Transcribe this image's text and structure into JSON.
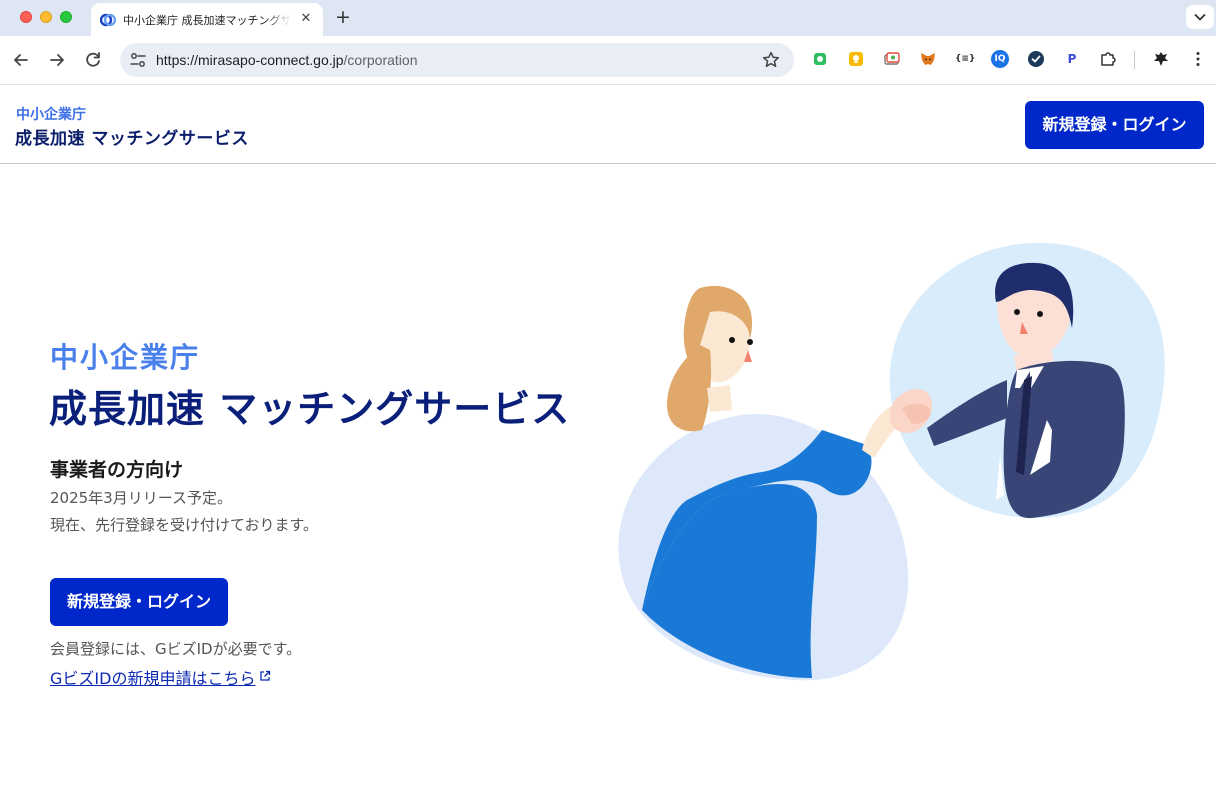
{
  "browser": {
    "tab_title": "中小企業庁 成長加速マッチングサービス",
    "url_host": "https://mirasapo-connect.go.jp",
    "url_path": "/corporation",
    "tab_close_glyph": "✕",
    "new_tab_glyph": "+",
    "extensions": [
      {
        "name": "evernote-extension-icon",
        "color": "#2dbe60"
      },
      {
        "name": "keep-extension-icon",
        "color": "#f9bb00"
      },
      {
        "name": "screenshot-extension-icon",
        "color": "#e04b3a"
      },
      {
        "name": "metamask-fox-icon",
        "color": "#e2761b"
      },
      {
        "name": "json-formatter-icon",
        "label": "{≡}"
      },
      {
        "name": "iq-extension-icon",
        "label": "IQ",
        "color": "#1a73e8"
      },
      {
        "name": "checkmark-extension-icon",
        "color": "#1b3a5c"
      },
      {
        "name": "paypal-extension-icon",
        "label": "P",
        "color": "#3b4bd8"
      },
      {
        "name": "puzzle-extensions-icon"
      },
      {
        "name": "profile-avatar-icon"
      }
    ]
  },
  "header": {
    "brand_small": "中小企業庁",
    "brand_big": "成長加速 マッチングサービス",
    "login_button": "新規登録・ログイン"
  },
  "hero": {
    "subtitle": "中小企業庁",
    "title": "成長加速 マッチングサービス",
    "audience": "事業者の方向け",
    "release_note": "2025年3月リリース予定。",
    "pre_registration": "現在、先行登録を受け付けております。",
    "cta_button": "新規登録・ログイン",
    "gbiz_note": "会員登録には、GビズIDが必要です。",
    "gbiz_link": "GビズIDの新規申請はこちら"
  },
  "colors": {
    "primary_button": "#0027c9",
    "brand_navy": "#0a1f7a",
    "brand_blue": "#4a80ec"
  }
}
